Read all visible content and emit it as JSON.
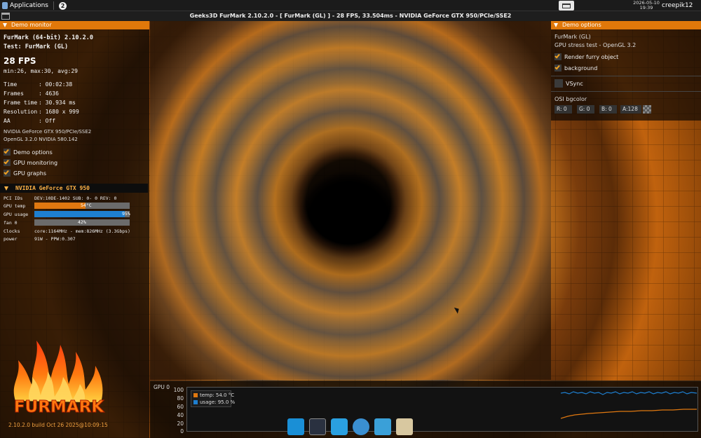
{
  "topbar": {
    "applications_label": "Applications",
    "workspace_badge": "2",
    "clock_date": "2026-05-10",
    "clock_time": "19:39",
    "user": "creepik12"
  },
  "window": {
    "title": "Geeks3D FurMark 2.10.2.0 - [ FurMark (GL) ] - 28 FPS, 33.504ms - NVIDIA GeForce GTX 950/PCIe/SSE2"
  },
  "demo_monitor": {
    "header": "Demo monitor",
    "version": "FurMark (64-bit) 2.10.2.0",
    "test": "Test: FurMark (GL)",
    "fps": "28 FPS",
    "minmax": "min:26, max:30, avg:29",
    "stats": [
      {
        "key": "Time",
        "value": ": 00:02:38"
      },
      {
        "key": "Frames",
        "value": ": 4636"
      },
      {
        "key": "Frame time",
        "value": ": 30.934 ms"
      },
      {
        "key": "Resolution",
        "value": ": 1680 x 999"
      },
      {
        "key": "AA",
        "value": ": Off"
      }
    ],
    "gpu_name": "NVIDIA GeForce GTX 950/PCIe/SSE2",
    "gl_version": "OpenGL 3.2.0 NVIDIA 580.142",
    "options": [
      {
        "label": "Demo options",
        "checked": true
      },
      {
        "label": "GPU monitoring",
        "checked": true
      },
      {
        "label": "GPU graphs",
        "checked": true
      }
    ]
  },
  "gpu_monitor": {
    "header": "NVIDIA GeForce GTX 950",
    "pci_label": "PCI IDs",
    "pci_value": "DEV:10DE-1402 SUB:   0-   0 REV: 0",
    "temp_label": "GPU temp",
    "temp_value": "54°C",
    "temp_fraction": 0.54,
    "usage_label": "GPU usage",
    "usage_value": "95%",
    "usage_fraction": 0.95,
    "fan_label": "fan 0",
    "fan_value": "42%",
    "fan_fraction": 0.42,
    "clocks_label": "Clocks",
    "clocks_value": "core:1164MHz - mem:826MHz (3.3Gbps)",
    "power_label": "power",
    "power_value": "91W - PPW:0.307",
    "colors": {
      "temp": "#e07810",
      "usage": "#1e7fd0",
      "fan": "#6b6b6b"
    }
  },
  "logo_text": "FURMARK",
  "build": "2.10.2.0 build Oct 26 2025@10:09:15",
  "demo_options": {
    "header": "Demo options",
    "name": "FurMark (GL)",
    "subtitle": "GPU stress test - OpenGL 3.2",
    "options": [
      {
        "label": "Render furry object",
        "checked": true
      },
      {
        "label": "background",
        "checked": true
      }
    ],
    "vsync": {
      "label": "VSync",
      "checked": false
    },
    "osi_label": "OSI bgcolor",
    "osi": {
      "r": "R: 0",
      "g": "G: 0",
      "b": "B: 0",
      "a": "A:128"
    }
  },
  "graph": {
    "label": "GPU 0",
    "yticks": [
      "100",
      "80",
      "60",
      "40",
      "20",
      "0"
    ],
    "legend": [
      {
        "label": "temp: 54.0 °C",
        "color": "#e07810"
      },
      {
        "label": "usage: 95.0 %",
        "color": "#1e7fd0"
      }
    ]
  },
  "dock": [
    {
      "name": "show-desktop-icon",
      "color": "#1a8fd6"
    },
    {
      "name": "terminal-icon",
      "color": "#2a3140"
    },
    {
      "name": "file-manager-icon",
      "color": "#2aa0e0"
    },
    {
      "name": "web-browser-icon",
      "color": "#3a8fd0"
    },
    {
      "name": "app-finder-icon",
      "color": "#3aa0d8"
    },
    {
      "name": "folder-icon",
      "color": "#d8c8a0"
    }
  ]
}
